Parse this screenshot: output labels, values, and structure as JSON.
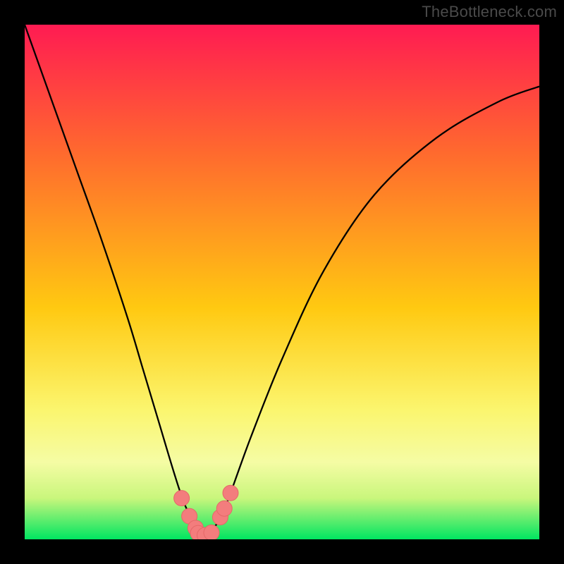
{
  "attribution": "TheBottleneck.com",
  "chart_data": {
    "type": "line",
    "title": "",
    "xlabel": "",
    "ylabel": "",
    "xlim": [
      0,
      100
    ],
    "ylim": [
      0,
      100
    ],
    "gradient_stops": [
      {
        "offset": 0,
        "color": "#ff1b52"
      },
      {
        "offset": 25,
        "color": "#ff6a2e"
      },
      {
        "offset": 55,
        "color": "#ffc911"
      },
      {
        "offset": 75,
        "color": "#fbf66f"
      },
      {
        "offset": 85,
        "color": "#f5fca4"
      },
      {
        "offset": 92,
        "color": "#c9f67c"
      },
      {
        "offset": 100,
        "color": "#00e561"
      }
    ],
    "series": [
      {
        "name": "bottleneck-curve",
        "x": [
          0,
          5,
          10,
          15,
          20,
          23,
          26,
          29,
          31,
          33,
          34,
          35,
          36,
          38,
          40,
          44,
          50,
          58,
          68,
          80,
          92,
          100
        ],
        "values": [
          100,
          86,
          72,
          58,
          43,
          33,
          23,
          13,
          7,
          3,
          1.5,
          0.8,
          1.5,
          4,
          9,
          20,
          35,
          52,
          67,
          78,
          85,
          88
        ]
      }
    ],
    "markers": {
      "name": "highlight-points",
      "color": "#f37d7d",
      "stroke": "#e56868",
      "radius": 11,
      "points": [
        {
          "x": 30.5,
          "y": 8
        },
        {
          "x": 32.0,
          "y": 4.5
        },
        {
          "x": 33.2,
          "y": 2.2
        },
        {
          "x": 33.7,
          "y": 1.2
        },
        {
          "x": 35.0,
          "y": 0.8
        },
        {
          "x": 36.3,
          "y": 1.3
        },
        {
          "x": 38.0,
          "y": 4.3
        },
        {
          "x": 38.8,
          "y": 6.0
        },
        {
          "x": 40.0,
          "y": 9.0
        }
      ]
    }
  }
}
